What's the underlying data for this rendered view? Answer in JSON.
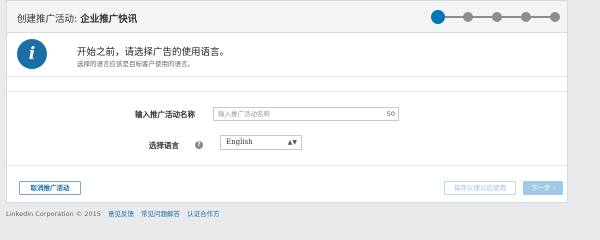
{
  "header": {
    "title_prefix": "创建推广活动:",
    "title_name": "企业推广快讯",
    "steps": {
      "total": 5,
      "current": 1
    }
  },
  "info": {
    "icon": "info-icon",
    "icon_glyph": "i",
    "main": "开始之前，请选择广告的使用语言。",
    "sub": "选择的语言应该是目标客户使用的语言。"
  },
  "form": {
    "name_label": "输入推广活动名称",
    "name_placeholder": "输入推广活动名称",
    "name_counter": "50",
    "language_label": "选择语言",
    "language_help": "?",
    "language_value": "English"
  },
  "buttons": {
    "cancel": "取消推广活动",
    "save": "保存以便以后使用",
    "next": "下一步 ›"
  },
  "footer": {
    "copyright": "LinkedIn Corporation © 2015",
    "links": [
      "意见反馈",
      "常见问题解答",
      "认证合作方"
    ]
  },
  "colors": {
    "accent": "#0077b5",
    "step_inactive": "#8b8d90",
    "info_icon": "#1a6fa8"
  }
}
